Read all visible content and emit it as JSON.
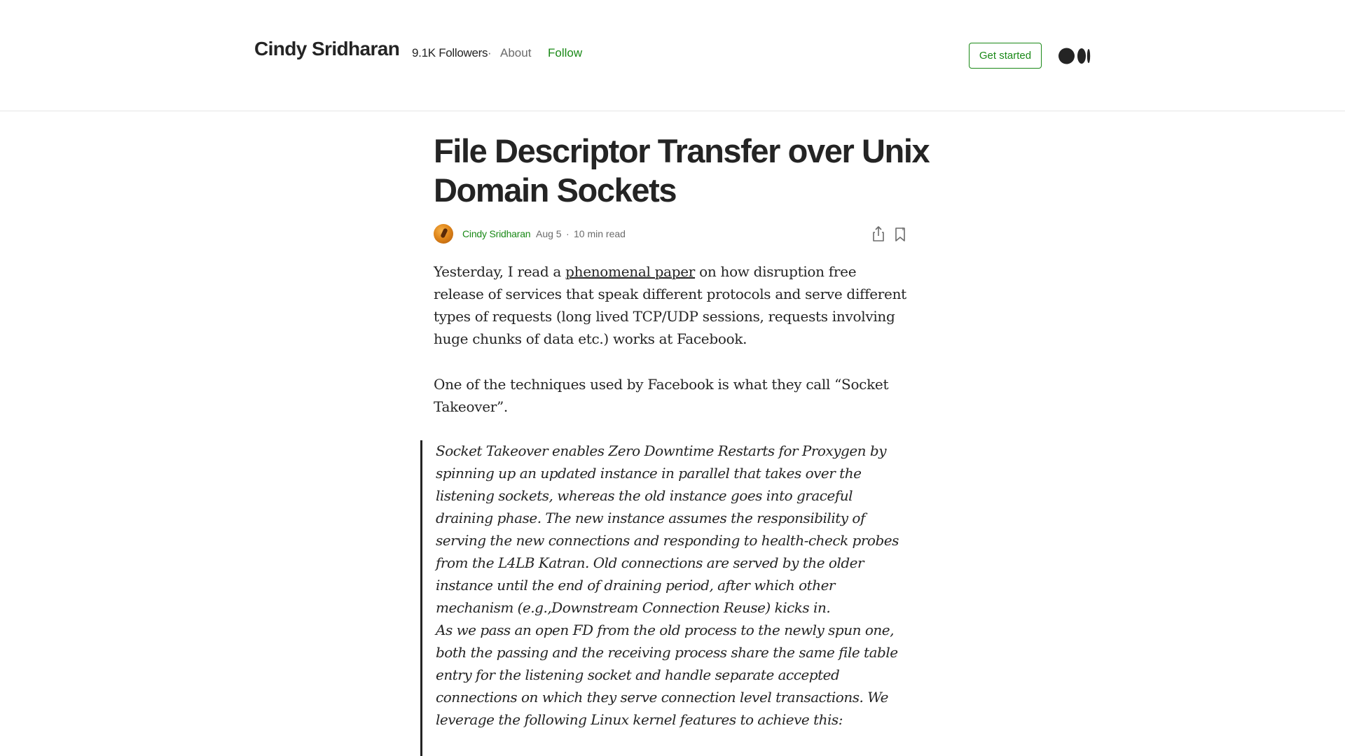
{
  "header": {
    "publication_name": "Cindy Sridharan",
    "followers": "9.1K Followers",
    "separator": "·",
    "about_label": "About",
    "follow_label": "Follow",
    "get_started_label": "Get started",
    "logo_icon": "medium-logo-icon"
  },
  "article": {
    "title": "File Descriptor Transfer over Unix Domain Sockets",
    "author": "Cindy Sridharan",
    "date": "Aug 5",
    "byline_separator": "·",
    "read_time": "10 min read",
    "share_icon": "share-icon",
    "bookmark_icon": "bookmark-icon",
    "p1_before_link": "Yesterday, I read a ",
    "p1_link": "phenomenal paper",
    "p1_after_link": " on how disruption free release of services that speak different protocols and serve different types of requests (long lived TCP/UDP sessions, requests involving huge chunks of data etc.) works at Facebook.",
    "p2": "One of the techniques used by Facebook is what they call “Socket Takeover”.",
    "quote_p1": "Socket Takeover enables Zero Downtime Restarts for Proxygen by spinning up an updated instance in parallel that takes over the listening sockets, whereas the old instance goes into graceful draining phase. The new instance assumes the responsibility of serving the new connections and responding to health-check probes from the L4LB Katran. Old connections are served by the older instance until the end of draining period, after which other mechanism (e.g.,Downstream Connection Reuse) kicks in.",
    "quote_p2": "As we pass an open FD from the old process to the newly spun one, both the passing and the receiving process share the same file table entry for the listening socket and handle separate accepted connections on which they serve connection level transactions. We leverage the following Linux kernel features to achieve this:"
  },
  "colors": {
    "accent_green": "#1a8917",
    "text": "#242424",
    "muted": "#6b6b6b"
  }
}
